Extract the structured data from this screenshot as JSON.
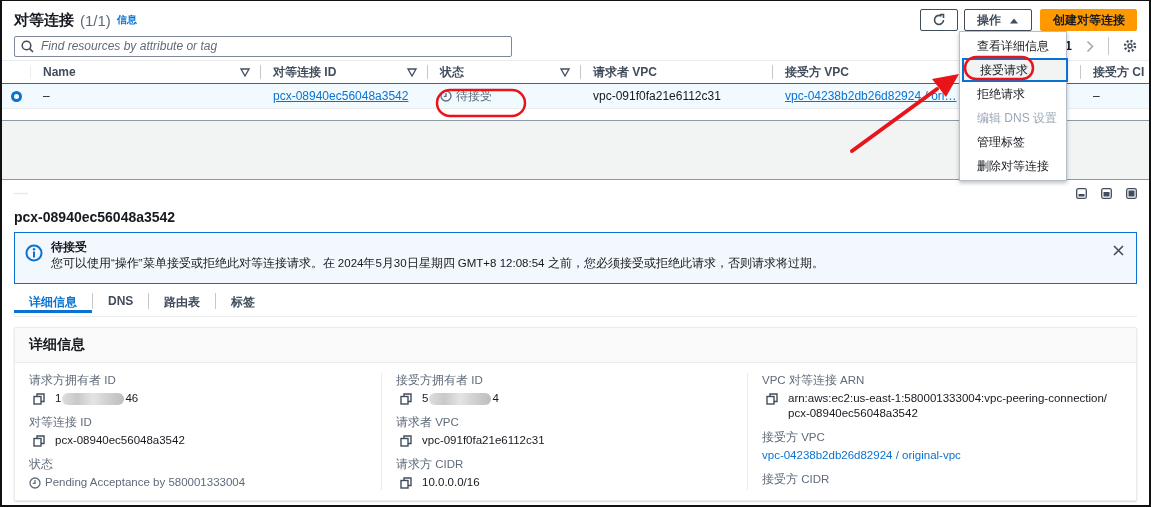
{
  "header": {
    "title": "对等连接",
    "count": "(1/1)",
    "info_link": "信息"
  },
  "toolbar": {
    "actions_button": {
      "label": "操作",
      "expanded": true
    },
    "create_button": "创建对等连接"
  },
  "search": {
    "placeholder": "Find resources by attribute or tag"
  },
  "pagination": {
    "page": "1"
  },
  "table": {
    "columns": [
      {
        "label": "Name",
        "filter": true
      },
      {
        "label": "对等连接 ID",
        "filter": true
      },
      {
        "label": "状态",
        "filter": true
      },
      {
        "label": "请求者 VPC",
        "filter": false
      },
      {
        "label": "接受方 VPC",
        "filter": false
      },
      {
        "label": "接受方 CI",
        "filter": false
      }
    ],
    "rows": [
      {
        "selected": true,
        "cells": [
          {
            "kind": "text",
            "text": "–"
          },
          {
            "kind": "link",
            "text": "pcx-08940ec56048a3542"
          },
          {
            "kind": "status",
            "text": "待接受"
          },
          {
            "kind": "text",
            "text": "vpc-091f0fa21e6112c31"
          },
          {
            "kind": "link",
            "text": "vpc-04238b2db26d82924 / ori…"
          },
          {
            "kind": "text",
            "text": "–"
          }
        ]
      }
    ]
  },
  "actions_menu": [
    {
      "label": "查看详细信息",
      "selected": false,
      "disabled": false
    },
    {
      "label": "接受请求",
      "selected": true,
      "disabled": false
    },
    {
      "label": "拒绝请求",
      "selected": false,
      "disabled": false
    },
    {
      "label": "编辑 DNS 设置",
      "selected": false,
      "disabled": true
    },
    {
      "label": "管理标签",
      "selected": false,
      "disabled": false
    },
    {
      "label": "删除对等连接",
      "selected": false,
      "disabled": false
    }
  ],
  "details": {
    "title": "pcx-08940ec56048a3542",
    "alert": {
      "title": "待接受",
      "message": "您可以使用“操作”菜单接受或拒绝此对等连接请求。在 2024年5月30日星期四 GMT+8 12:08:54 之前，您必须接受或拒绝此请求，否则请求将过期。"
    },
    "tabs": [
      {
        "label": "详细信息",
        "selected": true
      },
      {
        "label": "DNS",
        "selected": false
      },
      {
        "label": "路由表",
        "selected": false
      },
      {
        "label": "标签",
        "selected": false
      }
    ],
    "card": {
      "title": "详细信息",
      "columns": [
        [
          {
            "label": "请求方拥有者 ID",
            "kind": "masked",
            "value_start": "1",
            "value_end": "46"
          },
          {
            "label": "对等连接 ID",
            "kind": "copy",
            "value": "pcx-08940ec56048a3542"
          },
          {
            "label": "状态",
            "kind": "status",
            "value": "Pending Acceptance by 580001333004"
          }
        ],
        [
          {
            "label": "接受方拥有者 ID",
            "kind": "masked",
            "value_start": "5",
            "value_end": "4"
          },
          {
            "label": "请求者 VPC",
            "kind": "copy",
            "value": "vpc-091f0fa21e6112c31"
          },
          {
            "label": "请求方 CIDR",
            "kind": "copy",
            "value": "10.0.0.0/16"
          }
        ],
        [
          {
            "label": "VPC 对等连接 ARN",
            "kind": "copy",
            "value": "arn:aws:ec2:us-east-1:580001333004:vpc-peering-connection/pcx-08940ec56048a3542"
          },
          {
            "label": "接受方 VPC",
            "kind": "link",
            "value": "vpc-04238b2db26d82924 / original-vpc"
          },
          {
            "label": "接受方 CIDR",
            "kind": "label"
          }
        ]
      ]
    }
  }
}
